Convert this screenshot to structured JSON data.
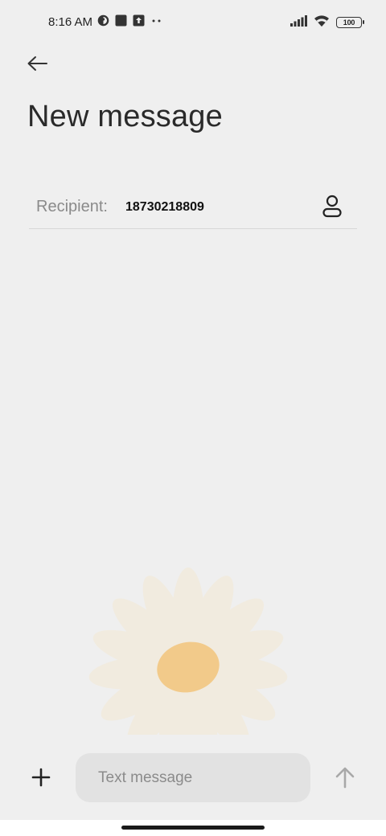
{
  "status_bar": {
    "time": "8:16 AM",
    "battery": "100",
    "left_icons": [
      "notification-circle-icon",
      "notification-square-icon",
      "upload-icon",
      "more-dots-icon"
    ],
    "right_icons": [
      "signal-icon",
      "wifi-icon",
      "battery-icon"
    ]
  },
  "header": {
    "back_icon": "arrow-left-icon",
    "title": "New message"
  },
  "recipient": {
    "label": "Recipient:",
    "value": "18730218809",
    "contact_icon": "person-icon"
  },
  "background_art": "daisy-flower",
  "composer": {
    "add_icon": "plus-icon",
    "placeholder": "Text message",
    "value": "",
    "send_icon": "arrow-up-icon"
  },
  "colors": {
    "background": "#efefef",
    "input_bg": "#e2e2e2",
    "petal": "#f1ebdf",
    "flower_center": "#f2ca8a"
  }
}
